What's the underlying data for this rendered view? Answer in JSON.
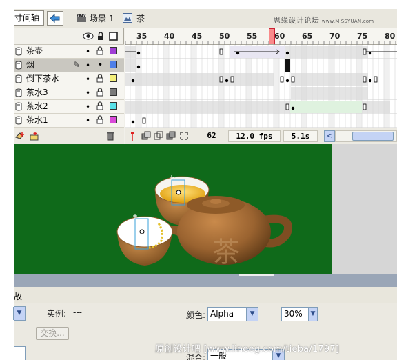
{
  "topbar": {
    "timeline_tab": "寸间轴",
    "scene_label": "场景 1",
    "symbol_label": "茶",
    "watermark_cn": "思缘设计论坛",
    "watermark_url": "www.MISSYUAN.com"
  },
  "timeline": {
    "ruler_ticks": [
      "35",
      "40",
      "45",
      "50",
      "55",
      "60",
      "65",
      "70",
      "75",
      "80"
    ],
    "layers": [
      {
        "name": "茶壶",
        "color": "#a03fd6",
        "selected": false
      },
      {
        "name": "烟",
        "color": "#4f7fe8",
        "selected": true
      },
      {
        "name": "倒下茶水",
        "color": "#f5f07a",
        "selected": false
      },
      {
        "name": "茶水3",
        "color": "#7a7a7a",
        "selected": false
      },
      {
        "name": "茶水2",
        "color": "#58e0e8",
        "selected": false
      },
      {
        "name": "茶水1",
        "color": "#d94ad9",
        "selected": false
      }
    ],
    "status": {
      "frame": "62",
      "fps": "12.0 fps",
      "time": "5.1s"
    }
  },
  "properties": {
    "header": "故",
    "instance_label": "实例:",
    "instance_value": "---",
    "swap_button": "交换...",
    "color_label": "颜色:",
    "color_value": "Alpha",
    "alpha_value": "30%",
    "blend_label": "混合:",
    "blend_value": "一般"
  },
  "watermark_bottom": "原创设计吧 [www.lineeg.com/tieba/1797]",
  "colors": {
    "stage_green": "#0f6a1a",
    "teapot_brown": "#8b5a2b",
    "tea_amber": "#f0b020",
    "playhead_red": "#e02020"
  }
}
